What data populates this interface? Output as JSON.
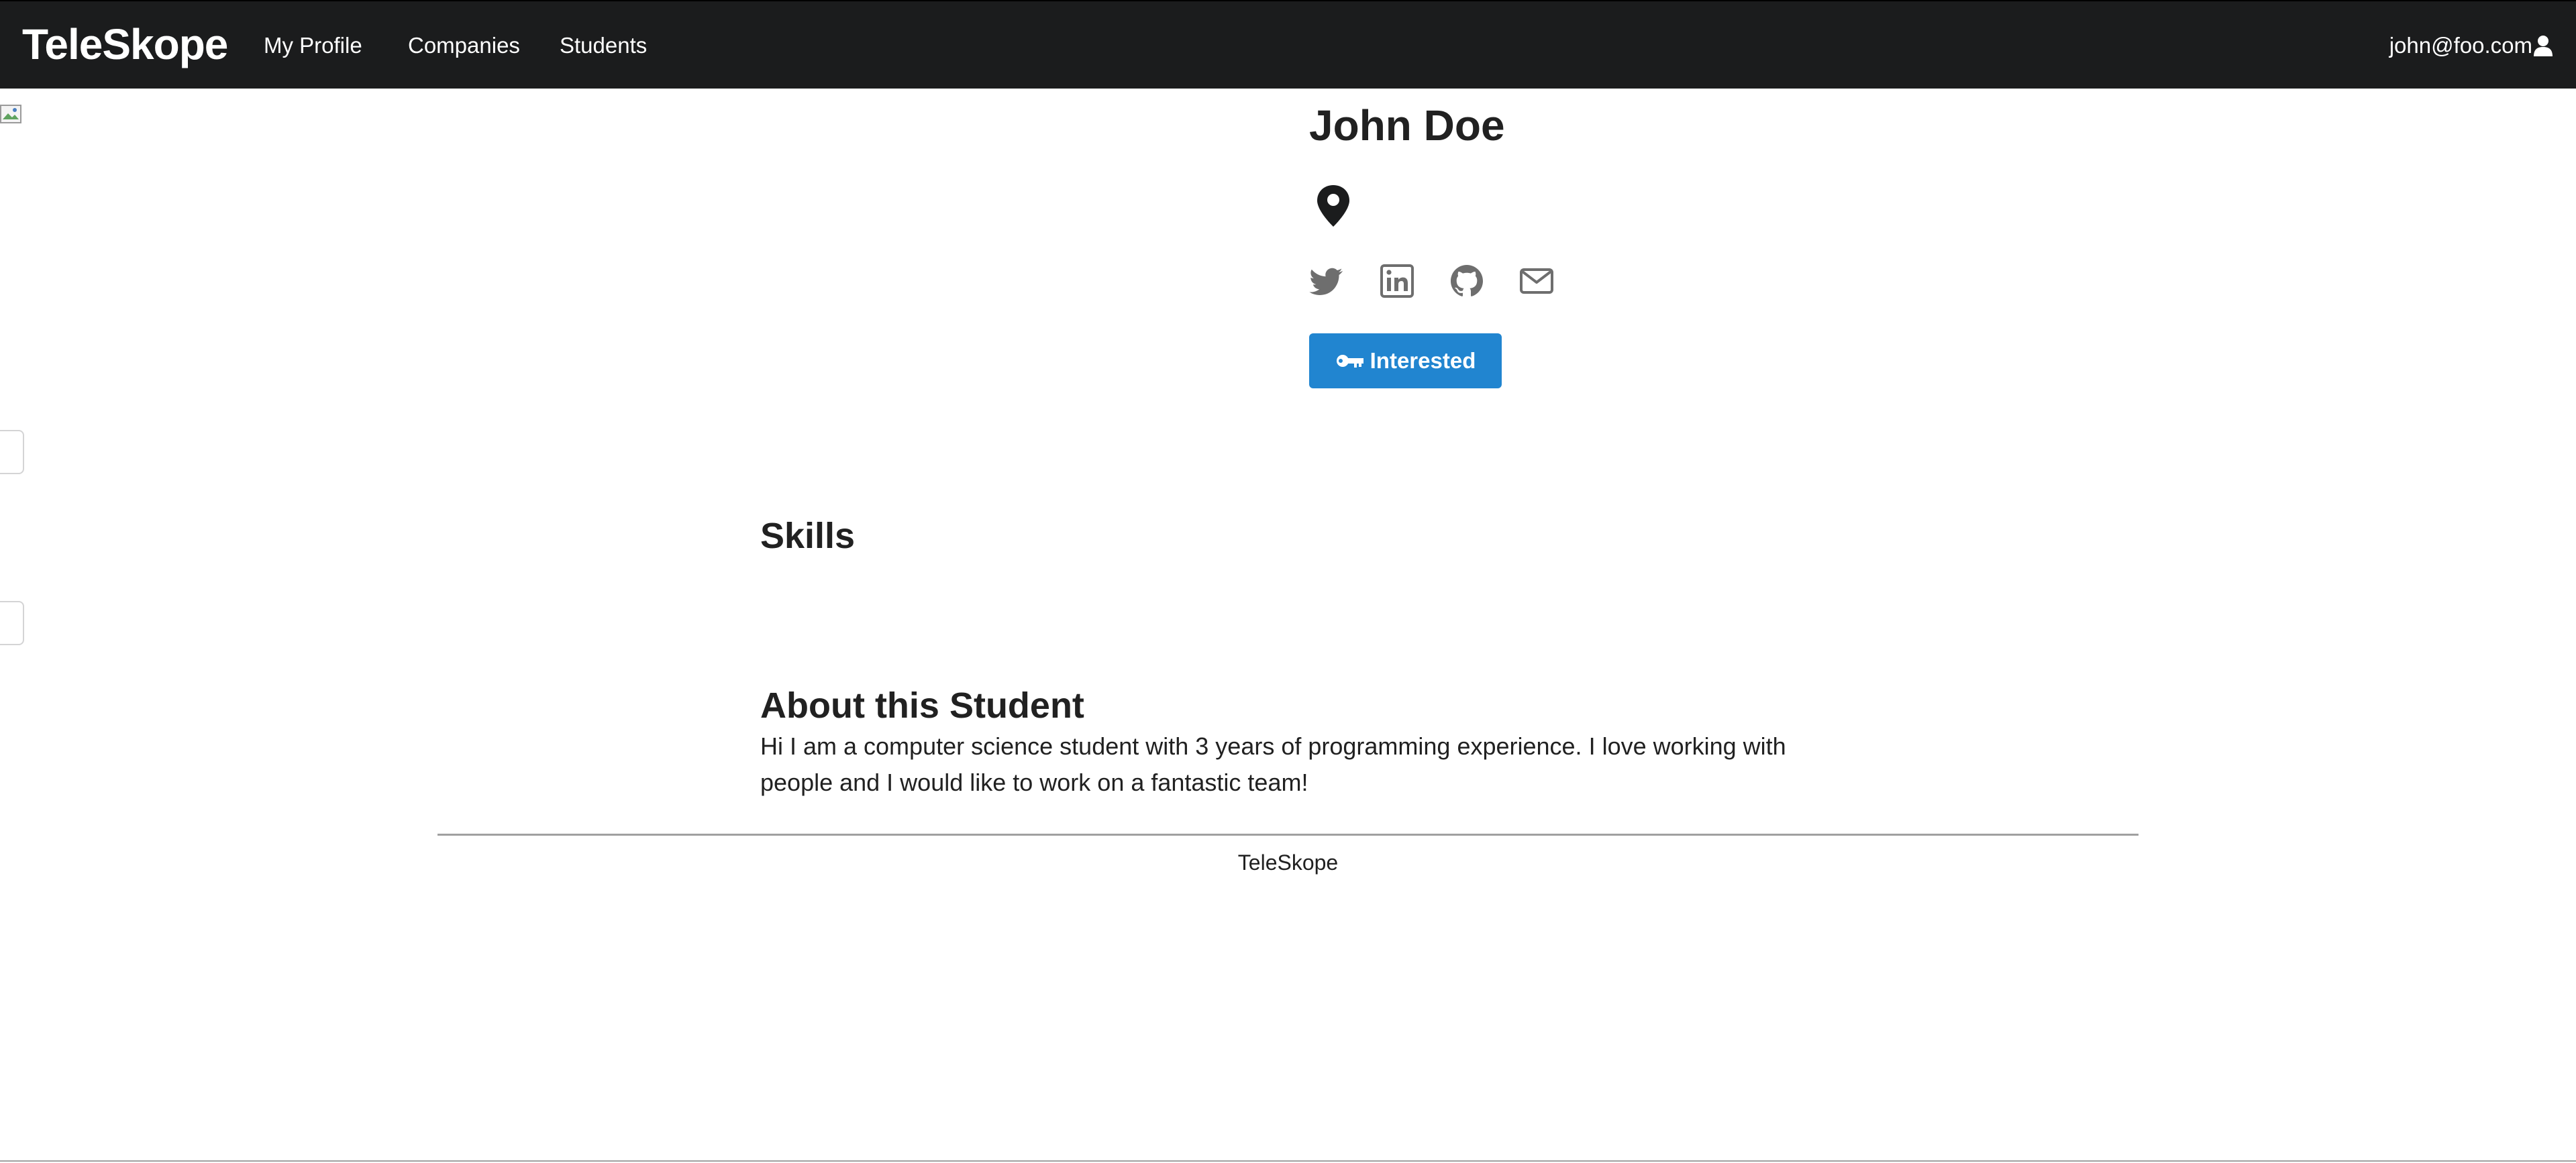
{
  "navbar": {
    "brand": "TeleSkope",
    "items": [
      {
        "label": "My Profile"
      },
      {
        "label": "Companies"
      },
      {
        "label": "Students"
      }
    ],
    "user_email": "john@foo.com",
    "user_icon": "user-icon"
  },
  "profile": {
    "name": "John Doe",
    "location_icon": "map-marker-icon",
    "socials": [
      {
        "icon": "twitter-icon"
      },
      {
        "icon": "linkedin-icon"
      },
      {
        "icon": "github-icon"
      },
      {
        "icon": "envelope-icon"
      }
    ],
    "interested_label": "Interested",
    "interested_icon": "key-icon"
  },
  "skills": {
    "heading": "Skills"
  },
  "about": {
    "heading": "About this Student",
    "text": "Hi I am a computer science student with 3 years of programming experience. I love working with people and I would like to work on a fantastic team!"
  },
  "footer": {
    "text": "TeleSkope"
  },
  "colors": {
    "navbar_bg": "#1b1c1d",
    "primary_button": "#2185d0",
    "icon_gray": "#6e6e6e"
  }
}
